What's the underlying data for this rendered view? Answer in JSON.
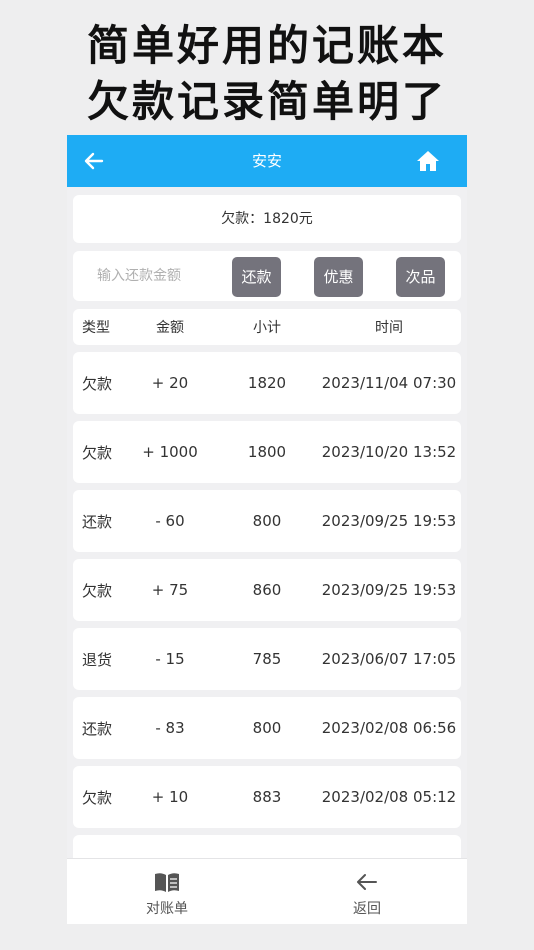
{
  "promo": {
    "line1": "简单好用的记账本",
    "line2": "欠款记录简单明了"
  },
  "header": {
    "title": "安安",
    "back_icon": "arrow-left-icon",
    "home_icon": "home-icon"
  },
  "debt": {
    "label": "欠款：1820元"
  },
  "actions": {
    "input_placeholder": "输入还款金额",
    "input_value": "",
    "repay": "还款",
    "discount": "优惠",
    "defect": "次品"
  },
  "columns": {
    "type": "类型",
    "amount": "金额",
    "subtotal": "小计",
    "time": "时间"
  },
  "records": [
    {
      "type": "欠款",
      "amount": "+ 20",
      "subtotal": "1820",
      "time": "2023/11/04 07:30"
    },
    {
      "type": "欠款",
      "amount": "+ 1000",
      "subtotal": "1800",
      "time": "2023/10/20 13:52"
    },
    {
      "type": "还款",
      "amount": "- 60",
      "subtotal": "800",
      "time": "2023/09/25 19:53"
    },
    {
      "type": "欠款",
      "amount": "+ 75",
      "subtotal": "860",
      "time": "2023/09/25 19:53"
    },
    {
      "type": "退货",
      "amount": "- 15",
      "subtotal": "785",
      "time": "2023/06/07 17:05"
    },
    {
      "type": "还款",
      "amount": "- 83",
      "subtotal": "800",
      "time": "2023/02/08 06:56"
    },
    {
      "type": "欠款",
      "amount": "+ 10",
      "subtotal": "883",
      "time": "2023/02/08 05:12"
    }
  ],
  "tabbar": {
    "statement": {
      "label": "对账单",
      "icon": "book-icon"
    },
    "back": {
      "label": "返回",
      "icon": "arrow-left-icon"
    }
  },
  "colors": {
    "header": "#1eacf4",
    "button": "#74737c",
    "background": "#f0f0f2"
  }
}
